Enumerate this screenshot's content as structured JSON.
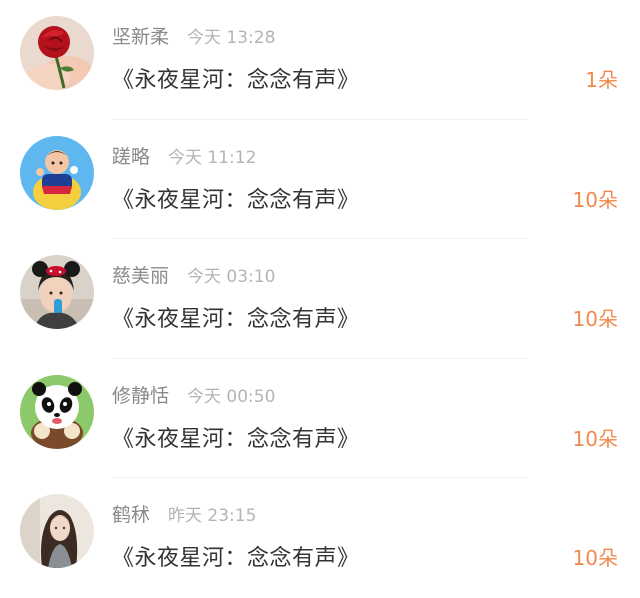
{
  "items": [
    {
      "name": "坚新柔",
      "time": "今天 13:28",
      "title": "《永夜星河：念念有声》",
      "count": "1朵",
      "avatar_icon": "rose-avatar"
    },
    {
      "name": "蹉略",
      "time": "今天 11:12",
      "title": "《永夜星河：念念有声》",
      "count": "10朵",
      "avatar_icon": "cartoon-character-avatar"
    },
    {
      "name": "慈美丽",
      "time": "今天 03:10",
      "title": "《永夜星河：念念有声》",
      "count": "10朵",
      "avatar_icon": "child-photo-avatar"
    },
    {
      "name": "修静恬",
      "time": "今天 00:50",
      "title": "《永夜星河：念念有声》",
      "count": "10朵",
      "avatar_icon": "panda-avatar"
    },
    {
      "name": "鹤秫",
      "time": "昨天 23:15",
      "title": "《永夜星河：念念有声》",
      "count": "10朵",
      "avatar_icon": "girl-photo-avatar"
    }
  ],
  "colors": {
    "accent": "#f08a4b",
    "name": "#8a8a8a",
    "time": "#b4b4b4",
    "title": "#333333"
  }
}
